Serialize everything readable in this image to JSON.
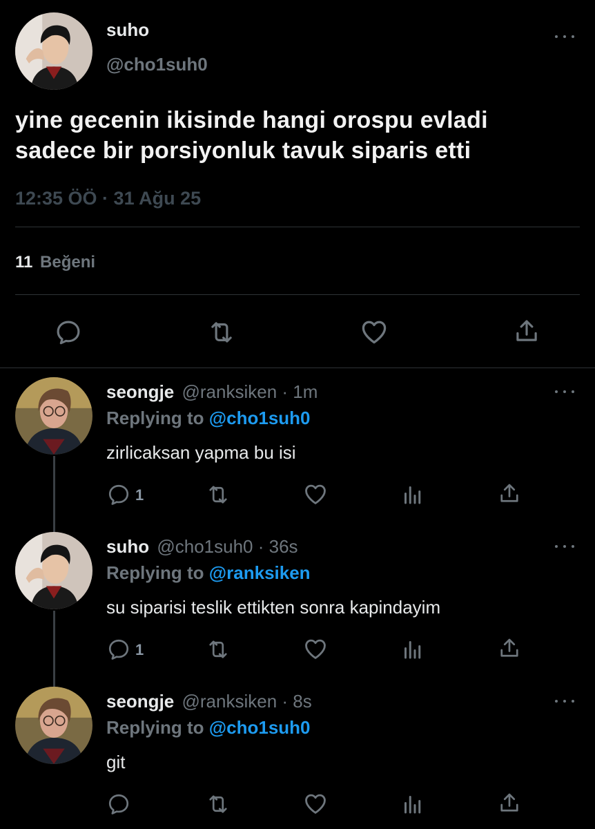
{
  "main_tweet": {
    "name": "suho",
    "handle": "@cho1suh0",
    "text_line1": "yine gecenin ikisinde hangi orospu evladi",
    "text_line2": "sadece bir porsiyonluk tavuk siparis etti",
    "timestamp": "12:35 ÖÖ · 31 Ağu 25",
    "likes_count": "11",
    "likes_label": "Beğeni"
  },
  "replies": [
    {
      "name": "seongje",
      "handle_time": "@ranksiken · 1m",
      "replying_prefix": "Replying to",
      "replying_to": "@cho1suh0",
      "text": "zirlicaksan yapma bu isi",
      "reply_count": "1"
    },
    {
      "name": "suho",
      "handle_time": "@cho1suh0 · 36s",
      "replying_prefix": "Replying to",
      "replying_to": "@ranksiken",
      "text": "su siparisi teslik ettikten sonra kapindayim",
      "reply_count": "1"
    },
    {
      "name": "seongje",
      "handle_time": "@ranksiken · 8s",
      "replying_prefix": "Replying to",
      "replying_to": "@cho1suh0",
      "text": "git",
      "reply_count": ""
    }
  ],
  "colors": {
    "background": "#000000",
    "text": "#e7e9ea",
    "muted": "#6e767d",
    "link": "#1d9bf0",
    "divider": "#2f3336"
  },
  "icons": [
    "more-icon",
    "reply-icon",
    "retweet-icon",
    "like-icon",
    "share-icon",
    "analytics-icon"
  ]
}
